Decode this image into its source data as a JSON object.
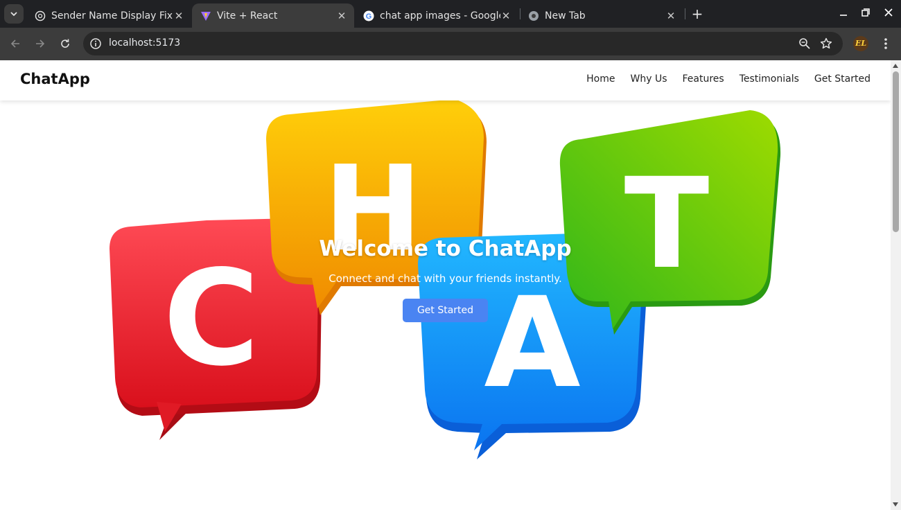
{
  "browser": {
    "tabs": [
      {
        "title": "Sender Name Display Fix",
        "icon": "openai-icon",
        "active": false
      },
      {
        "title": "Vite + React",
        "icon": "vite-icon",
        "active": true
      },
      {
        "title": "chat app images - Google",
        "icon": "google-icon",
        "active": false
      },
      {
        "title": "New Tab",
        "icon": "chrome-icon",
        "active": false
      }
    ],
    "url": "localhost:5173",
    "profile_initials": "EL"
  },
  "navbar": {
    "brand": "ChatApp",
    "links": [
      "Home",
      "Why Us",
      "Features",
      "Testimonials",
      "Get Started"
    ]
  },
  "hero": {
    "title": "Welcome to ChatApp",
    "subtitle": "Connect and chat with your friends instantly.",
    "cta": "Get Started",
    "image_letters": [
      "C",
      "H",
      "A",
      "T"
    ],
    "bubble_colors": {
      "C": "#e8202e",
      "H": "#f7a800",
      "A": "#0a8df2",
      "T": "#4cc21d"
    }
  },
  "colors": {
    "chrome_bg": "#202124",
    "toolbar_bg": "#3c3c3c",
    "cta_button": "#4a84f2"
  }
}
